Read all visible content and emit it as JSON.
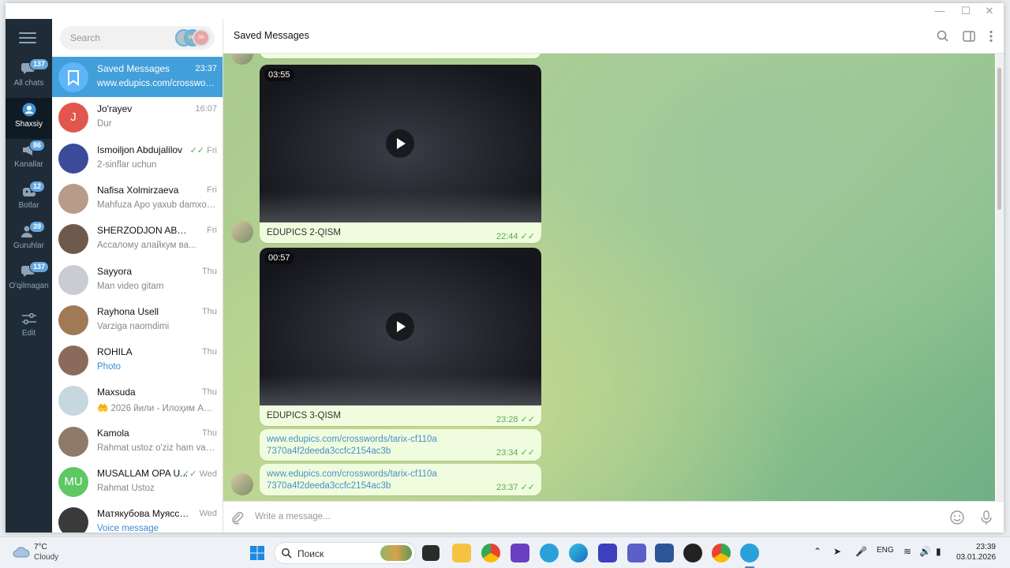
{
  "window": {
    "title": "Saved Messages"
  },
  "folders": [
    {
      "label": "All chats",
      "badge": "137",
      "icon": "chats-icon",
      "active": false
    },
    {
      "label": "Shaxsiy",
      "badge": "",
      "icon": "person-icon",
      "active": true
    },
    {
      "label": "Kanallar",
      "badge": "86",
      "icon": "megaphone-icon",
      "active": false
    },
    {
      "label": "Botlar",
      "badge": "12",
      "icon": "bot-icon",
      "active": false
    },
    {
      "label": "Guruhlar",
      "badge": "39",
      "icon": "group-icon",
      "active": false
    },
    {
      "label": "O'qilmagan",
      "badge": "137",
      "icon": "unread-icon",
      "active": false
    },
    {
      "label": "Edit",
      "badge": "",
      "icon": "sliders-icon",
      "active": false
    }
  ],
  "search": {
    "placeholder": "Search",
    "stories": [
      "",
      "MM",
      "SK"
    ]
  },
  "chats": [
    {
      "name": "Saved Messages",
      "time": "23:37",
      "preview": "www.edupics.com/crosswords/tarix-cf110a7370a4f2deeda3ccfc2154ac3b",
      "active": true,
      "avatar_color": "#5eb5f7",
      "avatar_text": ""
    },
    {
      "name": "Jo'rayev",
      "time": "16:07",
      "preview": "Dur",
      "avatar_color": "#e1574d",
      "avatar_text": "J"
    },
    {
      "name": "Ismoiljon Abdujalilov",
      "time": "Fri",
      "preview": "2-sinflar uchun",
      "read": true,
      "avatar_color": "#3b4a99",
      "avatar_text": ""
    },
    {
      "name": "Nafisa Xolmirzaeva",
      "time": "Fri",
      "preview": "Mahfuza Apo yaxub damxoy...",
      "avatar_color": "#b89c8a",
      "avatar_text": ""
    },
    {
      "name": "SHERZODJON ABDUSAT...",
      "time": "Fri",
      "preview": "Ассалому алайкум ва...",
      "avatar_color": "#6d5a4d",
      "avatar_text": ""
    },
    {
      "name": "Sayyora",
      "time": "Thu",
      "preview": "Man video gitam",
      "avatar_color": "#c9ccd2",
      "avatar_text": ""
    },
    {
      "name": "Rayhona Usell",
      "time": "Thu",
      "preview": "Varziga naomdimi",
      "avatar_color": "#a07a55",
      "avatar_text": ""
    },
    {
      "name": "ROHILA",
      "time": "Thu",
      "preview": "Photo",
      "preview_blue": true,
      "avatar_color": "#8a6a5a",
      "avatar_text": ""
    },
    {
      "name": "Maxsuda",
      "time": "Thu",
      "preview": "🤲 2026 йили - Илоҳим Алл...",
      "avatar_color": "#c7d7e0",
      "avatar_text": ""
    },
    {
      "name": "Kamola",
      "time": "Thu",
      "preview": "Rahmat ustoz o'ziz ham va oi...",
      "avatar_color": "#8f7a6a",
      "avatar_text": ""
    },
    {
      "name": "MUSALLAM OPA U...",
      "time": "Wed",
      "preview": "Rahmat Ustoz",
      "read": true,
      "avatar_color": "#5ec863",
      "avatar_text": "MU"
    },
    {
      "name": "Матякубова Муяссар...",
      "time": "Wed",
      "preview": "Voice message",
      "preview_blue": true,
      "avatar_color": "#3a3a3a",
      "avatar_text": ""
    }
  ],
  "header": {
    "title": "Saved Messages"
  },
  "messages": [
    {
      "type": "video",
      "duration": "03:55",
      "caption": "EDUPICS 2-QISM",
      "time": "22:44"
    },
    {
      "type": "video",
      "duration": "00:57",
      "caption": "EDUPICS 3-QISM",
      "time": "23:28"
    },
    {
      "type": "link",
      "text": "www.edupics.com/crosswords/tarix-cf110a7370a4f2deeda3ccfc2154ac3b",
      "time": "23:34"
    },
    {
      "type": "link",
      "text": "www.edupics.com/crosswords/tarix-cf110a7370a4f2deeda3ccfc2154ac3b",
      "time": "23:37"
    }
  ],
  "composer": {
    "placeholder": "Write a message..."
  },
  "taskbar": {
    "weather_temp": "7°C",
    "weather_cond": "Cloudy",
    "search_label": "Поиск",
    "lang": "ENG",
    "time": "23:39",
    "date": "03.01.2026"
  },
  "colors": {
    "accent": "#419fd9",
    "sidebar": "#1f2c38",
    "bubble": "#effdde",
    "badge": "#64a6e0"
  }
}
